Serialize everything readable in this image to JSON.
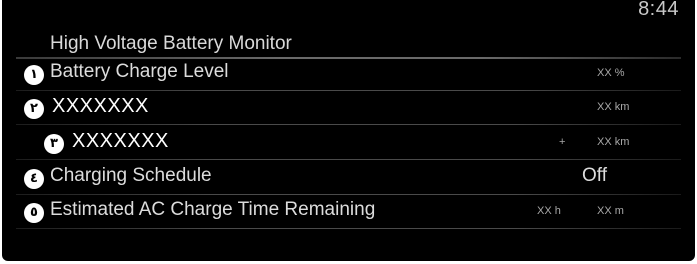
{
  "clock": "8:44",
  "page_title": "High Voltage Battery Monitor",
  "rows": [
    {
      "badge": "١",
      "label": "Battery Charge Level",
      "value": "XX %"
    },
    {
      "badge": "٢",
      "label": "XXXXXXX",
      "value": "XX km"
    },
    {
      "badge": "٣",
      "label": "XXXXXXX",
      "prefix": "+",
      "value": "XX km"
    },
    {
      "badge": "٤",
      "label": "Charging Schedule",
      "value": "Off"
    },
    {
      "badge": "٥",
      "label": "Estimated AC Charge Time Remaining",
      "hours": "XX h",
      "minutes": "XX m"
    }
  ],
  "colors": {
    "background": "#000000",
    "text": "#dcdcdc",
    "badge": "#ffffff"
  }
}
